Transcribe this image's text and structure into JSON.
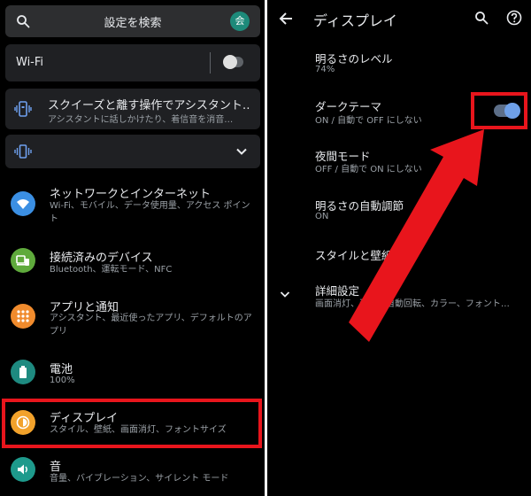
{
  "search": {
    "placeholder": "設定を検索",
    "avatar_letter": "会"
  },
  "wifi_card": {
    "label": "Wi-Fi",
    "enabled": false
  },
  "squeeze_card": {
    "title": "スクイーズと離す操作でアシスタント…",
    "subtitle": "アシスタントに話しかけたり、着信音を消音…"
  },
  "settings_list": [
    {
      "title": "ネットワークとインターネット",
      "subtitle": "Wi-Fi、モバイル、データ使用量、アクセス ポイント",
      "icon": "wifi-icon",
      "color": "#3b8fe3"
    },
    {
      "title": "接続済みのデバイス",
      "subtitle": "Bluetooth、運転モード、NFC",
      "icon": "devices-icon",
      "color": "#5faa3c"
    },
    {
      "title": "アプリと通知",
      "subtitle": "アシスタント、最近使ったアプリ、デフォルトのアプリ",
      "icon": "apps-icon",
      "color": "#f08b2d"
    },
    {
      "title": "電池",
      "subtitle": "100%",
      "icon": "battery-icon",
      "color": "#1e8a80"
    },
    {
      "title": "ディスプレイ",
      "subtitle": "スタイル、壁紙、画面消灯、フォントサイズ",
      "icon": "display-icon",
      "color": "#f2a22b"
    },
    {
      "title": "音",
      "subtitle": "音量、バイブレーション、サイレント モード",
      "icon": "sound-icon",
      "color": "#1e9a8c"
    }
  ],
  "display_screen": {
    "title": "ディスプレイ",
    "items": [
      {
        "title": "明るさのレベル",
        "subtitle": "74%"
      },
      {
        "title": "ダークテーマ",
        "subtitle": "ON / 自動で OFF にしない",
        "toggle_on": true
      },
      {
        "title": "夜間モード",
        "subtitle": "OFF / 自動で ON にしない"
      },
      {
        "title": "明るさの自動調節",
        "subtitle": "ON"
      },
      {
        "title": "スタイルと壁紙",
        "subtitle": ""
      },
      {
        "title": "詳細設定",
        "subtitle": "画面消灯、画面の自動回転、カラー、フォント…"
      }
    ]
  },
  "colors": {
    "highlight_red": "#e8151c",
    "toggle_accent": "#6ea0e8",
    "panel_bg": "#000000",
    "card_bg": "#1f2023"
  }
}
